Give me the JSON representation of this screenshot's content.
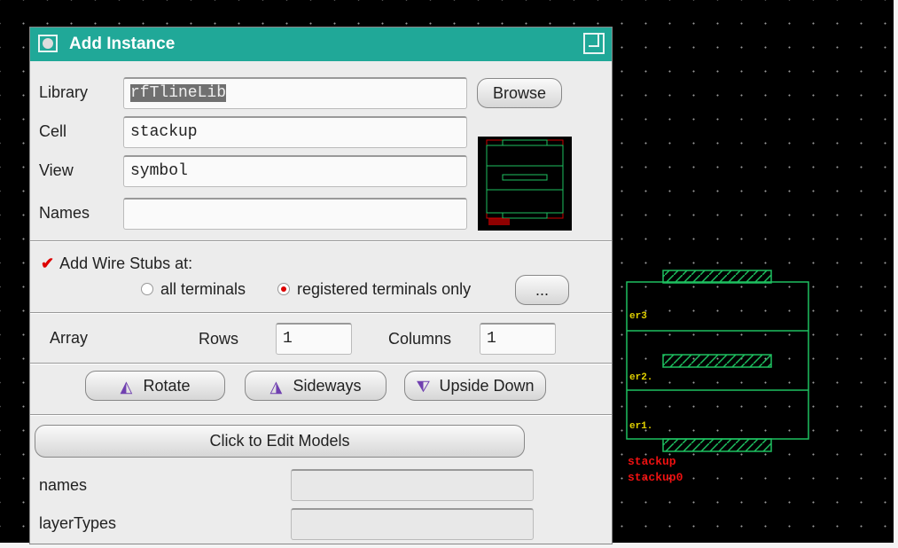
{
  "dialog": {
    "title": "Add Instance"
  },
  "fields": {
    "library": {
      "label": "Library",
      "value": "rfTlineLib"
    },
    "cell": {
      "label": "Cell",
      "value": "stackup"
    },
    "view": {
      "label": "View",
      "value": "symbol"
    },
    "names": {
      "label": "Names",
      "value": ""
    }
  },
  "browse_label": "Browse",
  "wire_stubs": {
    "label": "Add Wire Stubs at:",
    "checked": true,
    "options": [
      "all terminals",
      "registered terminals only"
    ],
    "selected": "registered terminals only",
    "more_label": "..."
  },
  "array": {
    "label": "Array",
    "rows_label": "Rows",
    "rows": "1",
    "columns_label": "Columns",
    "columns": "1"
  },
  "transforms": {
    "rotate": "Rotate",
    "sideways": "Sideways",
    "upside_down": "Upside Down"
  },
  "edit_models_label": "Click to Edit Models",
  "params": [
    {
      "label": "names",
      "value": ""
    },
    {
      "label": "layerTypes",
      "value": ""
    }
  ],
  "symbol": {
    "pins": [
      "er3",
      "er2.",
      "er1."
    ],
    "instance_lines": [
      "stackup",
      "stackup0"
    ]
  },
  "colors": {
    "title_bar": "#20a898",
    "symbol_line": "#1ec060",
    "pin_label": "#e0d000",
    "instance_label": "#ee1111"
  }
}
